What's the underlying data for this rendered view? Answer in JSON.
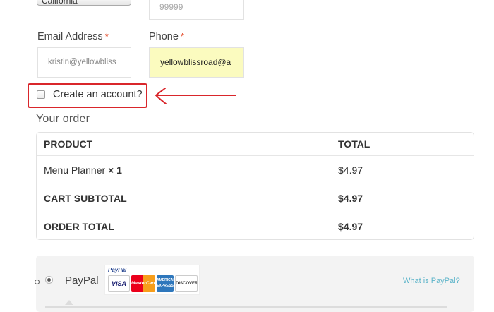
{
  "billing": {
    "state_value": "California",
    "zip_placeholder": "99999",
    "email_label": "Email Address",
    "email_required": "*",
    "email_value": "kristin@yellowbliss",
    "phone_label": "Phone",
    "phone_required": "*",
    "phone_value": "yellowblissroad@a",
    "create_account_label": "Create an account?",
    "create_account_checked": false
  },
  "annotation": {
    "color": "#d9262b"
  },
  "order": {
    "heading": "Your order",
    "columns": [
      "PRODUCT",
      "TOTAL"
    ],
    "item": {
      "name": "Menu Planner",
      "qty_text": "× 1",
      "total": "$4.97"
    },
    "cart_subtotal_label": "CART SUBTOTAL",
    "cart_subtotal_value": "$4.97",
    "order_total_label": "ORDER TOTAL",
    "order_total_value": "$4.97"
  },
  "payment": {
    "method_label": "PayPal",
    "logo_brand": "PayPal",
    "cards": [
      "VISA",
      "MasterCard",
      "AMERICAN EXPRESS",
      "DISCOVER"
    ],
    "what_is_link": "What is PayPal?",
    "link_color": "#5cb4c9"
  }
}
